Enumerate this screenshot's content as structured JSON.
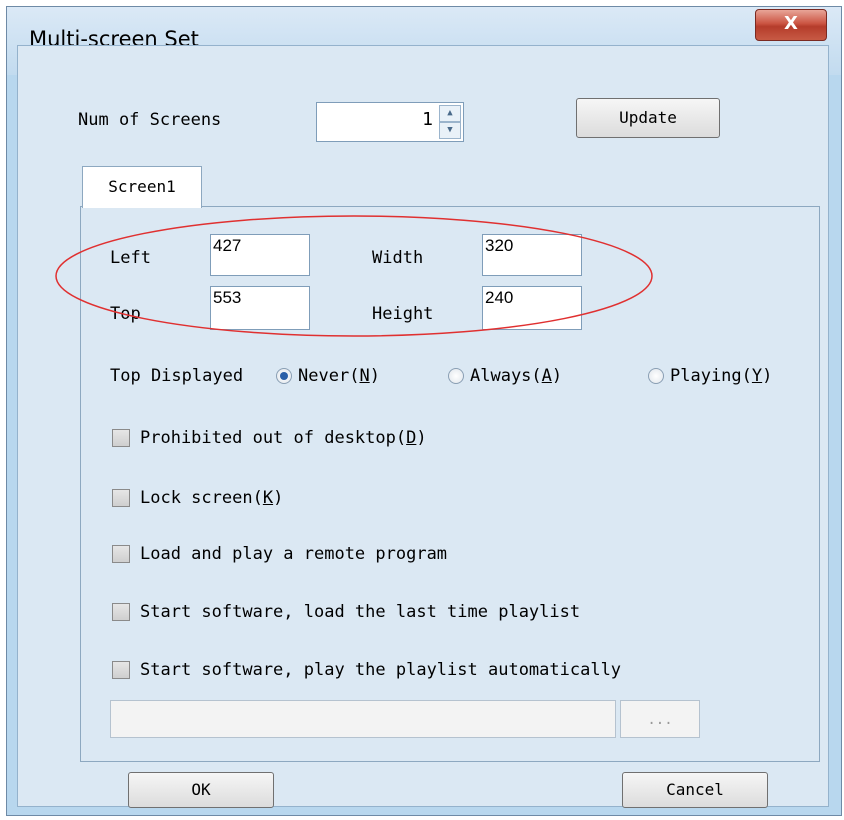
{
  "window": {
    "title": "Multi-screen Set",
    "close_label": "X"
  },
  "screens": {
    "label": "Num of Screens",
    "value": "1",
    "update_label": "Update"
  },
  "tab": {
    "label": "Screen1"
  },
  "position": {
    "left_label": "Left",
    "left_value": "427",
    "top_label": "Top",
    "top_value": "553",
    "width_label": "Width",
    "width_value": "320",
    "height_label": "Height",
    "height_value": "240"
  },
  "top_displayed": {
    "label": "Top Displayed",
    "options": [
      {
        "label": "Never",
        "key": "N",
        "checked": true
      },
      {
        "label": "Always",
        "key": "A",
        "checked": false
      },
      {
        "label": "Playing",
        "key": "Y",
        "checked": false
      }
    ]
  },
  "checkboxes": [
    {
      "label": "Prohibited out of desktop",
      "key": "D",
      "checked": false
    },
    {
      "label": "Lock screen",
      "key": "K",
      "checked": false
    },
    {
      "label": "Load and play a remote program",
      "key": "",
      "checked": false
    },
    {
      "label": "Start software, load the last time playlist",
      "key": "",
      "checked": false
    },
    {
      "label": "Start software, play the playlist automatically",
      "key": "",
      "checked": false
    }
  ],
  "playlist_path": {
    "value": "",
    "browse_label": "..."
  },
  "footer": {
    "ok_label": "OK",
    "cancel_label": "Cancel"
  },
  "annotation_color": "#e03030"
}
